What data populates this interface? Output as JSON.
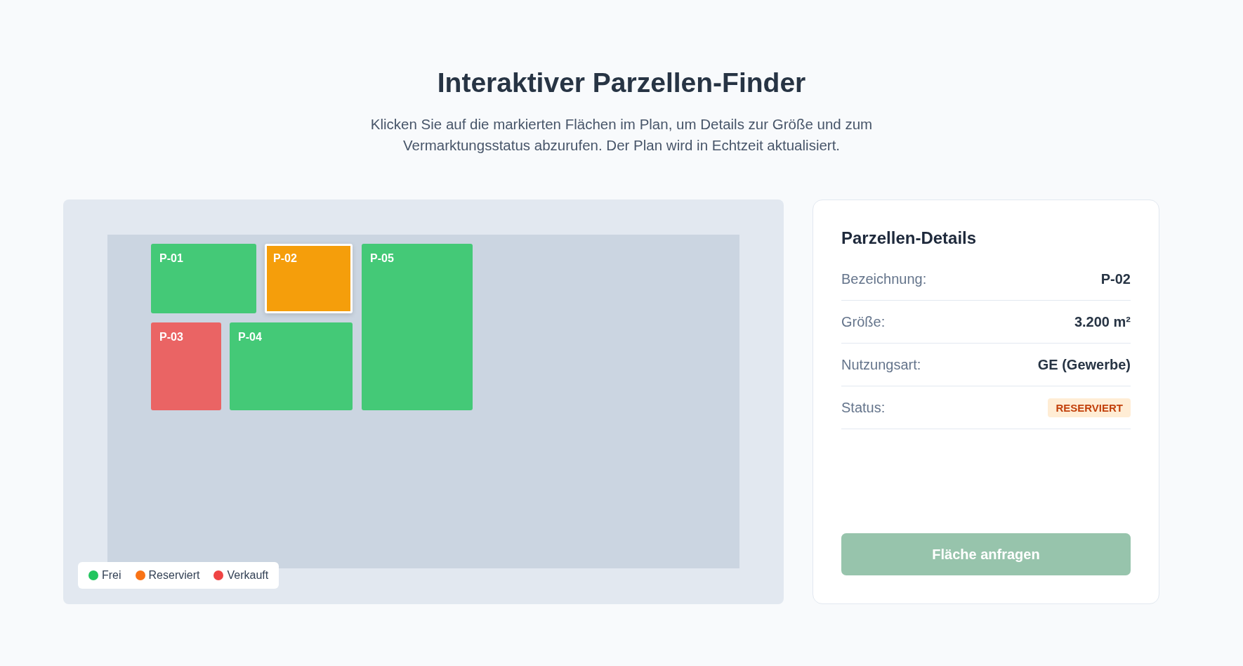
{
  "title": "Interaktiver Parzellen-Finder",
  "intro": "Klicken Sie auf die markierten Flächen im Plan, um Details zur Größe und zum Vermarktungsstatus abzurufen. Der Plan wird in Echtzeit aktualisiert.",
  "parcels": [
    {
      "label": "P-01",
      "color": "#44c977",
      "selected": false
    },
    {
      "label": "P-02",
      "color": "#f59e0b",
      "selected": true
    },
    {
      "label": "P-05",
      "color": "#44c977",
      "selected": false
    },
    {
      "label": "P-03",
      "color": "#ea6464",
      "selected": false
    },
    {
      "label": "P-04",
      "color": "#44c977",
      "selected": false
    }
  ],
  "legend": [
    {
      "label": "Frei",
      "color": "#22c55e"
    },
    {
      "label": "Reserviert",
      "color": "#f97316"
    },
    {
      "label": "Verkauft",
      "color": "#ef4444"
    }
  ],
  "details": {
    "title": "Parzellen-Details",
    "rows": [
      {
        "label": "Bezeichnung:",
        "value": "P-02",
        "kind": "text"
      },
      {
        "label": "Größe:",
        "value": "3.200 m²",
        "kind": "text"
      },
      {
        "label": "Nutzungsart:",
        "value": "GE (Gewerbe)",
        "kind": "text"
      },
      {
        "label": "Status:",
        "value": "RESERVIERT",
        "kind": "badge"
      }
    ],
    "button": {
      "label": "Fläche anfragen",
      "disabled": true
    }
  }
}
